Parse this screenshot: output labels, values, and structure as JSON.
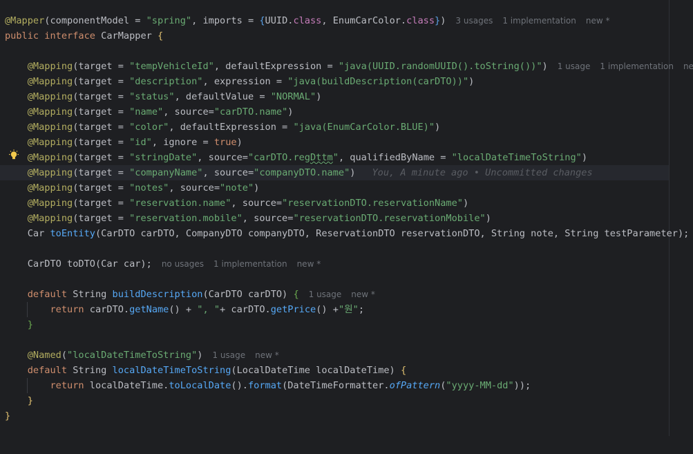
{
  "editor": {
    "hints": {
      "mapper_usages": "3 usages",
      "mapper_impl": "1 implementation",
      "mapper_new": "new *",
      "mapping_usage": "1 usage",
      "mapping_impl": "1 implementation",
      "mapping_new": "new *",
      "todto_usages": "no usages",
      "todto_impl": "1 implementation",
      "todto_new": "new *",
      "builddesc_usage": "1 usage",
      "builddesc_new": "new *",
      "named_usage": "1 usage",
      "named_new": "new *"
    },
    "blame": "You, A minute ago • Uncommitted changes",
    "lines": {
      "l1_ann": "@Mapper",
      "l1_a": "(componentModel = ",
      "l1_s1": "\"spring\"",
      "l1_b": ", imports = ",
      "l1_brace_open": "{",
      "l1_c1": "UUID.",
      "l1_k1": "class",
      "l1_d": ", EnumCarColor.",
      "l1_k2": "class",
      "l1_brace_close": "}",
      "l1_e": ")",
      "l2_kw1": "public",
      "l2_kw2": "interface",
      "l2_name": "CarMapper",
      "l2_brace": "{",
      "m1_ann": "@Mapping",
      "m1_a": "(target = ",
      "m1_s1": "\"tempVehicleId\"",
      "m1_b": ", defaultExpression = ",
      "m1_s2": "\"java(UUID.randomUUID().toString())\"",
      "m1_c": ")",
      "m2_ann": "@Mapping",
      "m2_a": "(target = ",
      "m2_s1": "\"description\"",
      "m2_b": ", expression = ",
      "m2_s2": "\"java(buildDescription(carDTO))\"",
      "m2_c": ")",
      "m3_ann": "@Mapping",
      "m3_a": "(target = ",
      "m3_s1": "\"status\"",
      "m3_b": ", defaultValue = ",
      "m3_s2": "\"NORMAL\"",
      "m3_c": ")",
      "m4_ann": "@Mapping",
      "m4_a": "(target = ",
      "m4_s1": "\"name\"",
      "m4_b": ", source=",
      "m4_s2": "\"carDTO.name\"",
      "m4_c": ")",
      "m5_ann": "@Mapping",
      "m5_a": "(target = ",
      "m5_s1": "\"color\"",
      "m5_b": ", defaultExpression = ",
      "m5_s2": "\"java(EnumCarColor.BLUE)\"",
      "m5_c": ")",
      "m6_ann": "@Mapping",
      "m6_a": "(target = ",
      "m6_s1": "\"id\"",
      "m6_b": ", ignore = ",
      "m6_k": "true",
      "m6_c": ")",
      "m7_ann": "@Mapping",
      "m7_a": "(target = ",
      "m7_s1": "\"stringDate\"",
      "m7_b": ", source=",
      "m7_s2a": "\"carDTO.reg",
      "m7_s2b": "Dttm",
      "m7_s2c": "\"",
      "m7_c": ", qualifiedByName = ",
      "m7_s3": "\"localDateTimeToString\"",
      "m7_d": ")",
      "m8_ann": "@Mapping",
      "m8_a": "(target = ",
      "m8_s1": "\"companyName\"",
      "m8_b": ", source=",
      "m8_s2": "\"companyDTO.name\"",
      "m8_c": ")",
      "m9_ann": "@Mapping",
      "m9_a": "(target = ",
      "m9_s1": "\"notes\"",
      "m9_b": ", source=",
      "m9_s2": "\"note\"",
      "m9_c": ")",
      "m10_ann": "@Mapping",
      "m10_a": "(target = ",
      "m10_s1": "\"reservation.name\"",
      "m10_b": ", source=",
      "m10_s2": "\"reservationDTO.reservationName\"",
      "m10_c": ")",
      "m11_ann": "@Mapping",
      "m11_a": "(target = ",
      "m11_s1": "\"reservation.mobile\"",
      "m11_b": ", source=",
      "m11_s2": "\"reservationDTO.reservationMobile\"",
      "m11_c": ")",
      "te_a": "Car ",
      "te_fn": "toEntity",
      "te_b": "(CarDTO carDTO, CompanyDTO companyDTO, ReservationDTO reservationDTO, String note, String testParameter);",
      "td_a": "CarDTO toDTO(Car car);",
      "bd_kw": "default",
      "bd_a": " String ",
      "bd_fn": "buildDescription",
      "bd_b": "(CarDTO carDTO) ",
      "bd_brace": "{",
      "br_kw": "return",
      "br_a": " carDTO.",
      "br_fn1": "getName",
      "br_b": "() + ",
      "br_s1": "\", \"",
      "br_c": "+ carDTO.",
      "br_fn2": "getPrice",
      "br_d": "() +",
      "br_s2": "\"원\"",
      "br_e": ";",
      "bd_close": "}",
      "nm_ann": "@Named",
      "nm_a": "(",
      "nm_s": "\"localDateTimeToString\"",
      "nm_b": ")",
      "ld_kw": "default",
      "ld_a": " String ",
      "ld_fn": "localDateTimeToString",
      "ld_b": "(LocalDateTime localDateTime) ",
      "ld_brace": "{",
      "lr_kw": "return",
      "lr_a": " localDateTime.",
      "lr_fn1": "toLocalDate",
      "lr_b": "().",
      "lr_fn2": "format",
      "lr_c": "(DateTimeFormatter.",
      "lr_fn3": "ofPattern",
      "lr_d": "(",
      "lr_s": "\"yyyy-MM-dd\"",
      "lr_e": "));",
      "ld_close": "}",
      "cls_close": "}"
    },
    "colors": {
      "background": "#1e1f22",
      "annotation": "#b3ae60",
      "keyword": "#cf8e6d",
      "string": "#6aab73",
      "function": "#56a8f5",
      "hint": "#6f737a"
    }
  }
}
